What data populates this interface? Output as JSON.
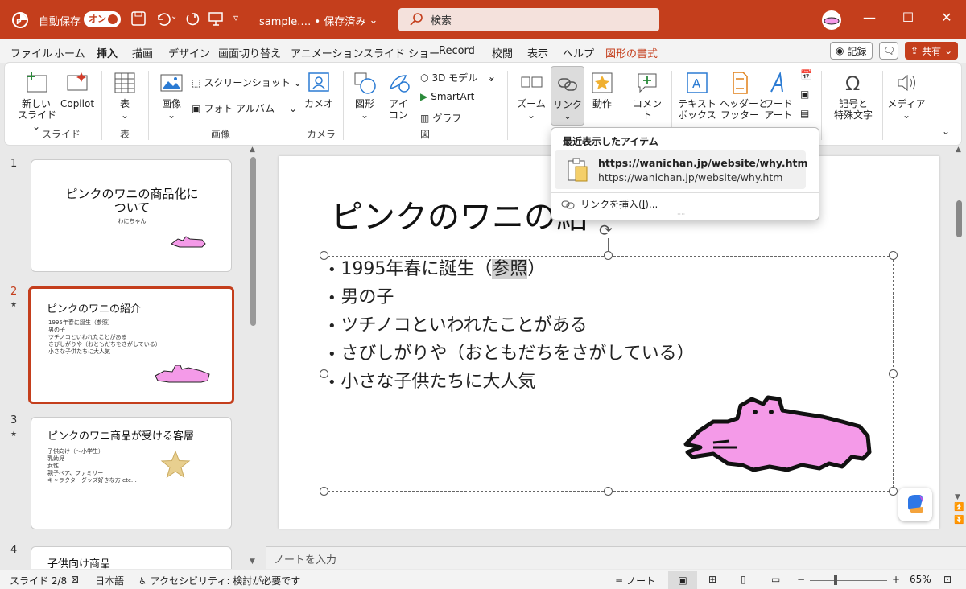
{
  "titlebar": {
    "autosave_label": "自動保存",
    "autosave_state": "オン",
    "filename": "sample.… • 保存済み",
    "search_placeholder": "検索"
  },
  "menu": {
    "items": [
      "ファイル",
      "ホーム",
      "挿入",
      "描画",
      "デザイン",
      "画面切り替え",
      "アニメーション",
      "スライド ショー",
      "Record",
      "校閲",
      "表示",
      "ヘルプ",
      "図形の書式"
    ],
    "active": "挿入",
    "record_btn": "記録",
    "share_btn": "共有"
  },
  "ribbon": {
    "new_slide": "新しい\nスライド",
    "copilot": "Copilot",
    "group_slide": "スライド",
    "table": "表",
    "group_table": "表",
    "image": "画像",
    "screenshot": "スクリーンショット",
    "photo_album": "フォト アルバム",
    "group_image": "画像",
    "cameo": "カメオ",
    "group_camera": "カメラ",
    "shapes": "図形",
    "icons": "アイ\nコン",
    "model3d": "3D モデル",
    "smartart": "SmartArt",
    "chart": "グラフ",
    "group_fig": "図",
    "zoom": "ズーム",
    "link": "リンク",
    "action": "動作",
    "comment": "コメント",
    "textbox": "テキスト\nボックス",
    "header_footer": "ヘッダーと\nフッター",
    "wordart": "ワード\nアート",
    "symbols": "記号と\n特殊文字",
    "media": "メディア"
  },
  "link_dropdown": {
    "header": "最近表示したアイテム",
    "recent_title": "https://wanichan.jp/website/why.htm",
    "recent_url": "https://wanichan.jp/website/why.htm",
    "insert_link": "リンクを挿入(I)...",
    "insert_link_main": "リンクを挿入(",
    "insert_link_key": "I",
    "insert_link_tail": ")..."
  },
  "slides": [
    {
      "num": "1",
      "title": "ピンクのワニの商品化に\nついて",
      "subtitle": "わにちゃん"
    },
    {
      "num": "2",
      "title": "ピンクのワニの紹介",
      "bullets": [
        "1995年春に誕生（参照）",
        "男の子",
        "ツチノコといわれたことがある",
        "さびしがりや（おともだちをさがしている）",
        "小さな子供たちに大人気"
      ]
    },
    {
      "num": "3",
      "title": "ピンクのワニ商品が受ける客層",
      "bullets": [
        "子供向け（〜小学生）",
        "乳幼児",
        "女性",
        "親子ペア、ファミリー",
        "キャラクターグッズ好きな方 etc…"
      ]
    },
    {
      "num": "4",
      "title": "子供向け商品"
    }
  ],
  "main_slide": {
    "title": "ピンクのワニの紹介",
    "title_visible": "ピンクのワニの紹",
    "bullet1_pre": "1995年春に誕生（",
    "bullet1_hl": "参照",
    "bullet1_post": "）",
    "bullets": [
      "男の子",
      "ツチノコといわれたことがある",
      "さびしがりや（おともだちをさがしている）",
      "小さな子供たちに大人気"
    ]
  },
  "notes_placeholder": "ノートを入力",
  "status": {
    "slide_info": "スライド 2/8",
    "language": "日本語",
    "accessibility": "アクセシビリティ: 検討が必要です",
    "notes_btn": "ノート",
    "zoom": "65%"
  },
  "colors": {
    "accent": "#c43e1c",
    "croc_pink": "#f49ae8"
  }
}
